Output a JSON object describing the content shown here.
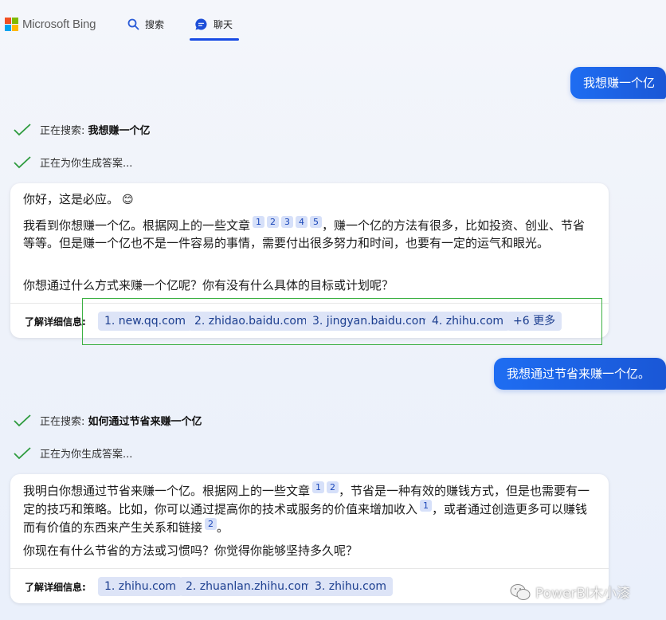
{
  "brand": {
    "name": "Microsoft Bing",
    "logo_colors": [
      "#f25022",
      "#7fba00",
      "#00a4ef",
      "#ffb900"
    ]
  },
  "nav": {
    "search_label": "搜索",
    "chat_label": "聊天",
    "active": "聊天",
    "accent": "#174ae4"
  },
  "conversation": {
    "turn1": {
      "user_message": "我想赚一个亿",
      "status_searching_prefix": "正在搜索: ",
      "status_searching_query": "我想赚一个亿",
      "status_generating": "正在为你生成答案...",
      "greeting": "你好，这是必应。",
      "greeting_emoji": "😊",
      "para1_text": "我看到你想赚一个亿。根据网上的一些文章",
      "para1_refs": [
        "1",
        "2",
        "3",
        "4",
        "5"
      ],
      "para1_rest": "，赚一个亿的方法有很多，比如投资、创业、节省等等。但是赚一个亿也不是一件容易的事情，需要付出很多努力和时间，也要有一定的运气和眼光。",
      "question": "你想通过什么方式来赚一个亿呢？你有没有什么具体的目标或计划呢？",
      "learn_more_label": "了解详细信息:",
      "sources": [
        "1. new.qq.com",
        "2. zhidao.baidu.com",
        "3. jingyan.baidu.com",
        "4. zhihu.com",
        "+6 更多"
      ]
    },
    "turn2": {
      "user_message": "我想通过节省来赚一个亿。",
      "status_searching_prefix": "正在搜索: ",
      "status_searching_query": "如何通过节省来赚一个亿",
      "status_generating": "正在为你生成答案...",
      "para1_a": "我明白你想通过节省来赚一个亿。根据网上的一些文章",
      "para1_refs_a": [
        "1",
        "2"
      ],
      "para1_b": "，节省是一种有效的赚钱方式，但是也需要有一定的技巧和策略。比如，你可以通过提高你的技术或服务的价值来增加收入",
      "para1_ref_b": "1",
      "para1_c": "，或者通过创造更多可以赚钱而有价值的东西来产生关系和链接",
      "para1_ref_c": "2",
      "para1_d": "。",
      "question": "你现在有什么节省的方法或习惯吗？你觉得你能够坚持多久呢？",
      "learn_more_label": "了解详细信息:",
      "sources": [
        "1. zhihu.com",
        "2. zhuanlan.zhihu.com",
        "3. zhihu.com"
      ]
    }
  },
  "watermark": {
    "text": "PowerBI木小漆",
    "icon": "wechat-icon"
  },
  "highlight_color": "#3cb043"
}
